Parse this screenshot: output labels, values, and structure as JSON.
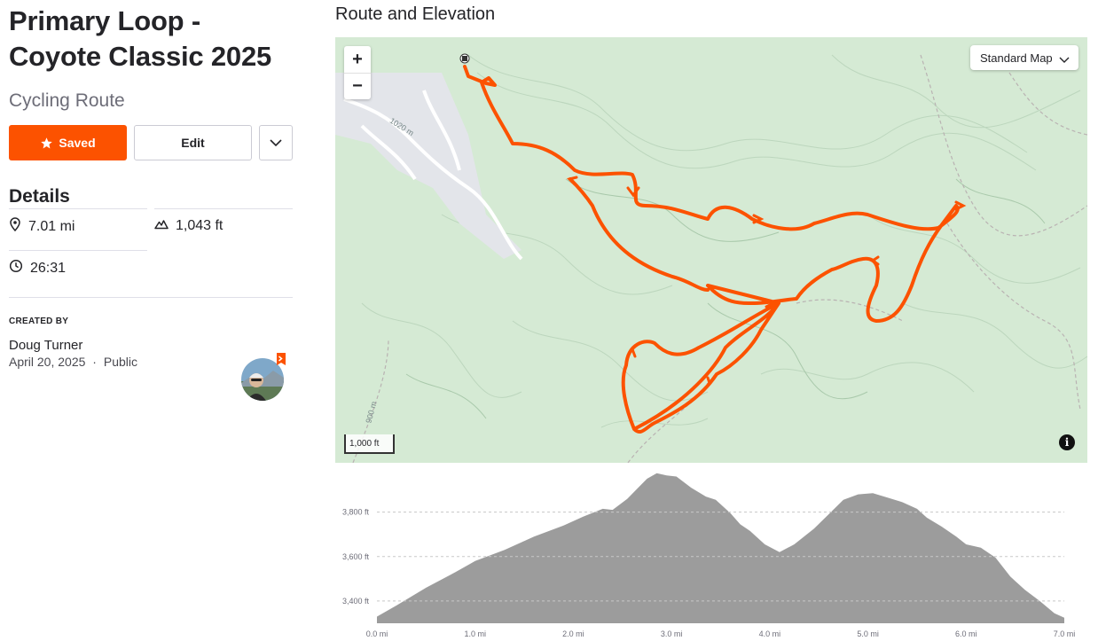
{
  "route": {
    "title": "Primary Loop -\nCoyote Classic 2025",
    "type": "Cycling Route"
  },
  "actions": {
    "saved_label": "Saved",
    "edit_label": "Edit"
  },
  "details": {
    "heading": "Details",
    "distance": "7.01 mi",
    "elevation_gain": "1,043 ft",
    "moving_time": "26:31"
  },
  "creator": {
    "label": "CREATED BY",
    "name": "Doug Turner",
    "date": "April 20, 2025",
    "separator": "·",
    "visibility": "Public"
  },
  "map": {
    "section_title": "Route and Elevation",
    "zoom_in": "+",
    "zoom_out": "−",
    "map_type": "Standard Map",
    "scale_label": "1,000 ft",
    "info": "i",
    "contour_labels": [
      "1020 m",
      "900 m"
    ],
    "route_color": "#fc5200",
    "terrain_color": "#d5ead4"
  },
  "chart_data": {
    "type": "area",
    "title": "",
    "xlabel": "",
    "ylabel": "",
    "x_unit": "mi",
    "y_unit": "ft",
    "xlim": [
      0,
      7
    ],
    "ylim": [
      3300,
      3990
    ],
    "x_ticks": [
      "0.0 mi",
      "1.0 mi",
      "2.0 mi",
      "3.0 mi",
      "4.0 mi",
      "5.0 mi",
      "6.0 mi",
      "7.0 mi"
    ],
    "y_ticks": [
      "3,400 ft",
      "3,600 ft",
      "3,800 ft"
    ],
    "grid": true,
    "fill_color": "#9c9c9c",
    "series": [
      {
        "x": [
          0.0,
          0.2,
          0.5,
          0.8,
          1.0,
          1.3,
          1.6,
          1.9,
          2.1,
          2.3,
          2.4,
          2.55,
          2.65,
          2.75,
          2.85,
          2.95,
          3.05,
          3.2,
          3.35,
          3.45,
          3.6,
          3.7,
          3.8,
          3.95,
          4.1,
          4.25,
          4.45,
          4.6,
          4.75,
          4.9,
          5.05,
          5.2,
          5.35,
          5.5,
          5.6,
          5.75,
          5.9,
          6.0,
          6.15,
          6.3,
          6.45,
          6.6,
          6.75,
          6.9,
          7.0
        ],
        "y": [
          3330,
          3380,
          3460,
          3530,
          3580,
          3630,
          3690,
          3740,
          3780,
          3815,
          3810,
          3860,
          3905,
          3950,
          3975,
          3965,
          3960,
          3910,
          3870,
          3855,
          3795,
          3745,
          3715,
          3655,
          3620,
          3655,
          3725,
          3790,
          3855,
          3880,
          3885,
          3865,
          3845,
          3815,
          3775,
          3735,
          3690,
          3655,
          3640,
          3595,
          3510,
          3450,
          3400,
          3345,
          3325
        ]
      }
    ]
  }
}
